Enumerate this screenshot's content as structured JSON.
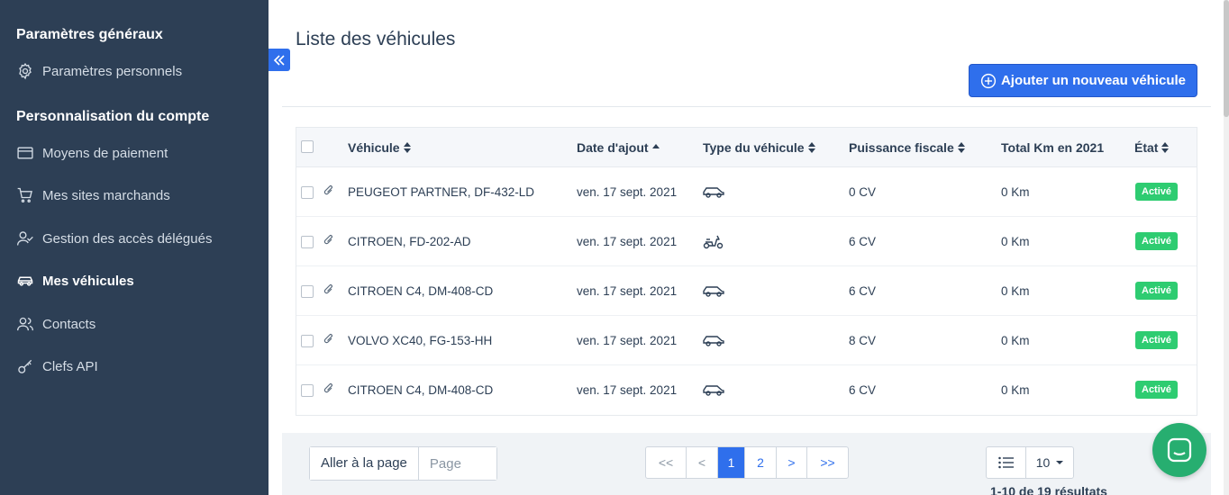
{
  "sidebar": {
    "section_general": "Paramètres généraux",
    "section_account": "Personnalisation du compte",
    "items": [
      {
        "label": "Paramètres personnels",
        "icon": "gear-icon"
      },
      {
        "label": "Moyens de paiement",
        "icon": "credit-card-icon"
      },
      {
        "label": "Mes sites marchands",
        "icon": "cart-icon"
      },
      {
        "label": "Gestion des accès délégués",
        "icon": "user-check-icon"
      },
      {
        "label": "Mes véhicules",
        "icon": "car-icon",
        "active": true
      },
      {
        "label": "Contacts",
        "icon": "users-icon"
      },
      {
        "label": "Clefs API",
        "icon": "key-icon"
      }
    ]
  },
  "main": {
    "title": "Liste des véhicules",
    "add_button": "Ajouter un nouveau véhicule"
  },
  "table": {
    "columns": [
      "Véhicule",
      "Date d'ajout",
      "Type du véhicule",
      "Puissance fiscale",
      "Total Km en 2021",
      "État"
    ],
    "rows": [
      {
        "vehicle": "PEUGEOT PARTNER, DF-432-LD",
        "date": "ven. 17 sept. 2021",
        "type": "car-icon",
        "power": "0 CV",
        "km": "0 Km",
        "status": "Activé"
      },
      {
        "vehicle": "CITROEN, FD-202-AD",
        "date": "ven. 17 sept. 2021",
        "type": "scooter-icon",
        "power": "6 CV",
        "km": "0 Km",
        "status": "Activé"
      },
      {
        "vehicle": "CITROEN C4, DM-408-CD",
        "date": "ven. 17 sept. 2021",
        "type": "car-icon",
        "power": "6 CV",
        "km": "0 Km",
        "status": "Activé"
      },
      {
        "vehicle": "VOLVO XC40, FG-153-HH",
        "date": "ven. 17 sept. 2021",
        "type": "car-icon",
        "power": "8 CV",
        "km": "0 Km",
        "status": "Activé"
      },
      {
        "vehicle": "CITROEN C4, DM-408-CD",
        "date": "ven. 17 sept. 2021",
        "type": "car-icon",
        "power": "6 CV",
        "km": "0 Km",
        "status": "Activé"
      }
    ]
  },
  "pagination": {
    "goto_label": "Aller à la page",
    "goto_placeholder": "Page",
    "first": "<<",
    "prev": "<",
    "pages": [
      "1",
      "2"
    ],
    "current": "1",
    "next": ">",
    "last": ">>",
    "per_page": "10",
    "results": "1-10 de 19 résultats"
  },
  "colors": {
    "sidebar_bg": "#2d3f55",
    "accent": "#2f6fec",
    "status_active": "#2ecc71",
    "chat": "#27ae70"
  }
}
